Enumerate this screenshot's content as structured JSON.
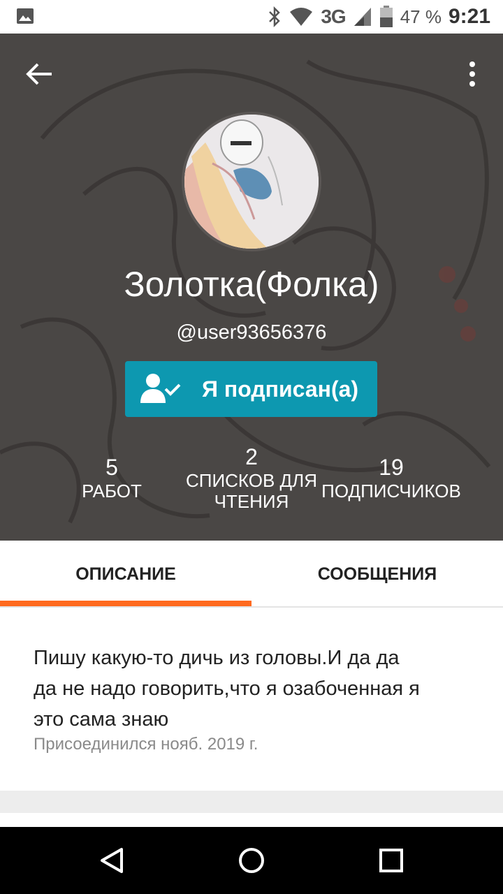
{
  "status_bar": {
    "network": "3G",
    "battery_pct": "47 %",
    "time": "9:21"
  },
  "profile": {
    "display_name": "Золотка(Фолка)",
    "username": "@user93656376",
    "follow_label": "Я подписан(а)"
  },
  "stats": [
    {
      "value": "5",
      "label": "РАБОТ"
    },
    {
      "value": "2",
      "label_line1": "СПИСКОВ ДЛЯ",
      "label_line2": "ЧТЕНИЯ"
    },
    {
      "value": "19",
      "label": "ПОДПИСЧИКОВ"
    }
  ],
  "tabs": [
    {
      "label": "ОПИСАНИЕ",
      "active": true
    },
    {
      "label": "СООБЩЕНИЯ",
      "active": false
    }
  ],
  "about": {
    "description_line1": "Пишу какую-то дичь из головы.И да да",
    "description_line2": "да не надо говорить,что я озабоченная я",
    "description_line3": "это сама знаю",
    "joined": "Присоединился нояб. 2019 г."
  },
  "colors": {
    "accent_orange": "#ff6a1f",
    "follow_button": "#0d98b0",
    "header_bg": "#4a4745"
  },
  "icons": [
    "gallery-icon",
    "bluetooth-icon",
    "wifi-icon",
    "signal-icon",
    "battery-icon",
    "back-arrow-icon",
    "more-vertical-icon",
    "user-check-icon",
    "nav-back-icon",
    "nav-home-icon",
    "nav-recents-icon"
  ]
}
